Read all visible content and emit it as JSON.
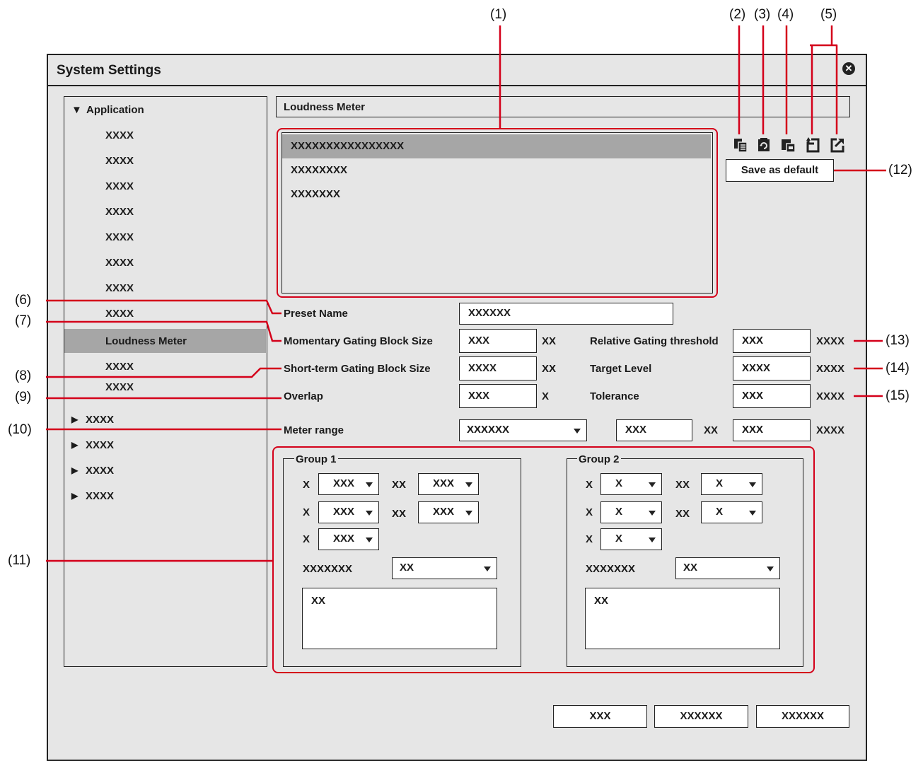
{
  "dialog": {
    "title": "System Settings"
  },
  "tree": {
    "application_label": "Application",
    "sub_items": [
      "XXXX",
      "XXXX",
      "XXXX",
      "XXXX",
      "XXXX",
      "XXXX",
      "XXXX",
      "XXXX"
    ],
    "selected_label": "Loudness Meter",
    "after_items": [
      "XXXX",
      "XXXX"
    ],
    "collapsed_items": [
      "XXXX",
      "XXXX",
      "XXXX",
      "XXXX"
    ]
  },
  "section_title": "Loudness Meter",
  "presets": [
    "XXXXXXXXXXXXXXXX",
    "XXXXXXXX",
    "XXXXXXX"
  ],
  "save_default_label": "Save as default",
  "form": {
    "preset_name_label": "Preset Name",
    "preset_name_value": "XXXXXX",
    "momentary_label": "Momentary Gating Block Size",
    "momentary_value": "XXX",
    "momentary_unit": "XX",
    "shortterm_label": "Short-term Gating Block Size",
    "shortterm_value": "XXXX",
    "shortterm_unit": "XX",
    "overlap_label": "Overlap",
    "overlap_value": "XXX",
    "overlap_unit": "X",
    "meter_range_label": "Meter range",
    "meter_range_select": "XXXXXX",
    "meter_range_value": "XXX",
    "meter_range_unit": "XX",
    "meter_range_value2": "XXX",
    "meter_range_unit2": "XXXX",
    "relative_label": "Relative Gating threshold",
    "relative_value": "XXX",
    "relative_unit": "XXXX",
    "target_label": "Target Level",
    "target_value": "XXXX",
    "target_unit": "XXXX",
    "tolerance_label": "Tolerance",
    "tolerance_value": "XXX",
    "tolerance_unit": "XXXX"
  },
  "group1": {
    "title": "Group 1",
    "row_label": "X",
    "mid_label": "XX",
    "r1a": "XXX",
    "r1b": "XXX",
    "r2a": "XXX",
    "r2b": "XXX",
    "r3a": "XXX",
    "setting_label": "XXXXXXX",
    "setting_value": "XX",
    "text_value": "XX"
  },
  "group2": {
    "title": "Group 2",
    "row_label": "X",
    "mid_label": "XX",
    "r1a": "X",
    "r1b": "X",
    "r2a": "X",
    "r2b": "X",
    "r3a": "X",
    "setting_label": "XXXXXXX",
    "setting_value": "XX",
    "text_value": "XX"
  },
  "footer_buttons": [
    "XXX",
    "XXXXXX",
    "XXXXXX"
  ],
  "callouts": {
    "c1": "(1)",
    "c2": "(2)",
    "c3": "(3)",
    "c4": "(4)",
    "c5": "(5)",
    "c6": "(6)",
    "c7": "(7)",
    "c8": "(8)",
    "c9": "(9)",
    "c10": "(10)",
    "c11": "(11)",
    "c12": "(12)",
    "c13": "(13)",
    "c14": "(14)",
    "c15": "(15)"
  },
  "colors": {
    "callout_red": "#d4001a",
    "selection": "#a6a6a6",
    "background": "#e6e6e6"
  }
}
